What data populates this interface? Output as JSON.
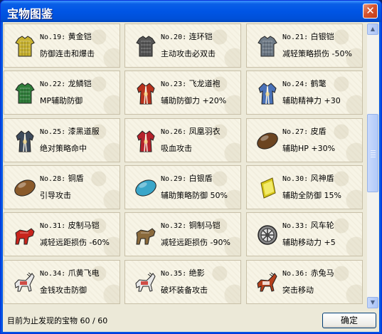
{
  "window": {
    "title": "宝物图鉴",
    "close_label": "✕"
  },
  "items": [
    {
      "num": "No.19:",
      "name": "黄金铠",
      "desc": "防御连击和爆击",
      "icon": "gold-armor-icon",
      "color": "#c8b230"
    },
    {
      "num": "No.20:",
      "name": "连环铠",
      "desc": "主动攻击必双击",
      "icon": "chain-armor-icon",
      "color": "#555555"
    },
    {
      "num": "No.21:",
      "name": "白银铠",
      "desc": "减轻策略损伤 -50%",
      "icon": "silver-armor-icon",
      "color": "#6e7a86"
    },
    {
      "num": "No.22:",
      "name": "龙鳞铠",
      "desc": "MP辅助防御",
      "icon": "dragon-scale-armor-icon",
      "color": "#2f7d3a"
    },
    {
      "num": "No.23:",
      "name": "飞龙道袍",
      "desc": "辅助防御力 +20%",
      "icon": "dragon-robe-icon",
      "color": "#b8321d"
    },
    {
      "num": "No.24:",
      "name": "鹤氅",
      "desc": "辅助精神力 +30",
      "icon": "crane-cloak-icon",
      "color": "#4a72b8"
    },
    {
      "num": "No.25:",
      "name": "漆黑道服",
      "desc": "绝对策略命中",
      "icon": "black-robe-icon",
      "color": "#3e4b5c"
    },
    {
      "num": "No.26:",
      "name": "凤凰羽衣",
      "desc": "吸血攻击",
      "icon": "phoenix-robe-icon",
      "color": "#b5222c"
    },
    {
      "num": "No.27:",
      "name": "皮盾",
      "desc": "辅助HP +30%",
      "icon": "leather-shield-icon",
      "color": "#6b4420"
    },
    {
      "num": "No.28:",
      "name": "铜盾",
      "desc": "引导攻击",
      "icon": "bronze-shield-icon",
      "color": "#8a5a2a"
    },
    {
      "num": "No.29:",
      "name": "白银盾",
      "desc": "辅助策略防御 50%",
      "icon": "silver-shield-icon",
      "color": "#3aa6c9"
    },
    {
      "num": "No.30:",
      "name": "风神盾",
      "desc": "辅助全防御 15%",
      "icon": "wind-god-shield-icon",
      "color": "#d8c81c"
    },
    {
      "num": "No.31:",
      "name": "皮制马铠",
      "desc": "减轻远距损伤 -60%",
      "icon": "leather-horse-armor-icon",
      "color": "#c8241c"
    },
    {
      "num": "No.32:",
      "name": "铜制马铠",
      "desc": "减轻远距损伤 -90%",
      "icon": "bronze-horse-armor-icon",
      "color": "#8a6a3c"
    },
    {
      "num": "No.33:",
      "name": "风车轮",
      "desc": "辅助移动力 +5",
      "icon": "windmill-wheel-icon",
      "color": "#555555"
    },
    {
      "num": "No.34:",
      "name": "爪黄飞电",
      "desc": "金钱攻击防御",
      "icon": "horse-white-icon",
      "color": "#7a7a7a"
    },
    {
      "num": "No.35:",
      "name": "绝影",
      "desc": "破坏装备攻击",
      "icon": "horse-shadow-icon",
      "color": "#555555"
    },
    {
      "num": "No.36:",
      "name": "赤兔马",
      "desc": "突击移动",
      "icon": "red-hare-horse-icon",
      "color": "#b5401c"
    }
  ],
  "status": {
    "text": "目前为止发现的宝物 60 / 60"
  },
  "ok_button": {
    "label": "确定"
  },
  "scrollbar": {
    "up": "▲",
    "down": "▼"
  }
}
